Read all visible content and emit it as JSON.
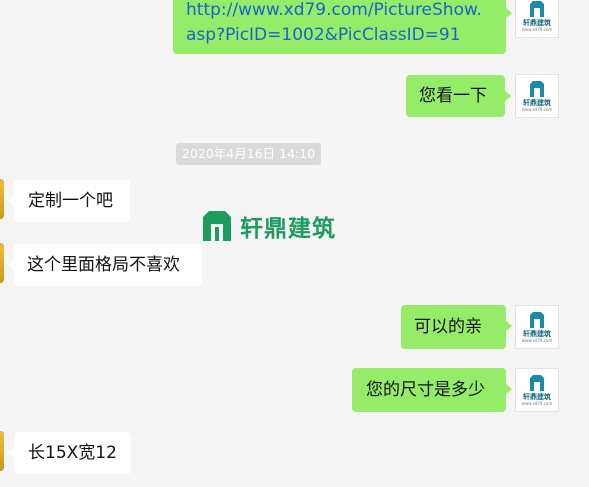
{
  "brand": {
    "avatar_caption": "轩鼎建筑",
    "avatar_sub": "www.xd79.com",
    "watermark_text": "轩鼎建筑",
    "color_green_bubble": "#95ec69",
    "color_brand": "#1e9c5e"
  },
  "messages": [
    {
      "side": "right",
      "line1": "http://www.xd79.com/PictureShow.",
      "line2": "asp?PicID=1002&PicClassID=91"
    },
    {
      "side": "right",
      "text": "您看一下"
    },
    {
      "side": "left",
      "text": "定制一个吧"
    },
    {
      "side": "left",
      "text": "这个里面格局不喜欢"
    },
    {
      "side": "right",
      "text": "可以的亲"
    },
    {
      "side": "right",
      "text": "您的尺寸是多少"
    },
    {
      "side": "left",
      "text": "长15X宽12"
    }
  ],
  "timestamp": "2020年4月16日 14:10"
}
